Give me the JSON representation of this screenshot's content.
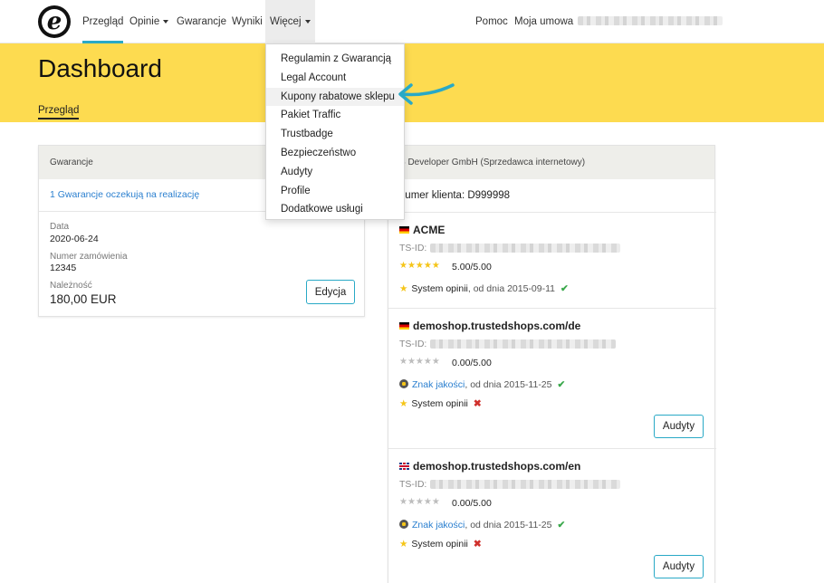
{
  "nav": {
    "items": [
      {
        "label": "Przegląd"
      },
      {
        "label": "Opinie"
      },
      {
        "label": "Gwarancje"
      },
      {
        "label": "Wyniki"
      },
      {
        "label": "Więcej"
      }
    ],
    "right": [
      {
        "label": "Pomoc"
      },
      {
        "label": "Moja umowa"
      }
    ],
    "logo_letter": "e"
  },
  "hero": {
    "title": "Dashboard",
    "subtab": "Przegląd"
  },
  "dropdown": {
    "items": [
      {
        "label": "Regulamin z Gwarancją"
      },
      {
        "label": "Legal Account"
      },
      {
        "label": "Kupony rabatowe sklepu"
      },
      {
        "label": "Pakiet Traffic"
      },
      {
        "label": "Trustbadge"
      },
      {
        "label": "Bezpieczeństwo"
      },
      {
        "label": "Audyty"
      },
      {
        "label": "Profile"
      },
      {
        "label": "Dodatkowe usługi"
      }
    ]
  },
  "guarantee_card": {
    "header": "Gwarancje",
    "pending_link": "1 Gwarancje oczekują na realizację",
    "date_label": "Data",
    "date_value": "2020-06-24",
    "order_label": "Numer zamówienia",
    "order_value": "12345",
    "due_label": "Należność",
    "due_value": "180,00 EUR",
    "edit_button": "Edycja"
  },
  "seller_card": {
    "header": "S Developer GmbH (Sprzedawca internetowy)",
    "client_number": "Numer klienta: D999998",
    "tsid_label": "TS-ID:",
    "shops": [
      {
        "name": "ACME",
        "flag": "de",
        "rating": "5.00/5.00",
        "stars_filled": 5,
        "reviews_text": "System opinii",
        "reviews_since": ", od dnia 2015-09-11",
        "reviews_ok": true
      },
      {
        "name": "demoshop.trustedshops.com/de",
        "flag": "de",
        "rating": "0.00/5.00",
        "stars_filled": 0,
        "quality_link": "Znak jakości",
        "quality_since": ", od dnia 2015-11-25",
        "reviews_text": "System opinii",
        "reviews_ok": false,
        "audit_button": "Audyty"
      },
      {
        "name": "demoshop.trustedshops.com/en",
        "flag": "gb",
        "rating": "0.00/5.00",
        "stars_filled": 0,
        "quality_link": "Znak jakości",
        "quality_since": ", od dnia 2015-11-25",
        "reviews_text": "System opinii",
        "reviews_ok": false,
        "audit_button": "Audyty"
      }
    ]
  },
  "colors": {
    "brand_yellow": "#fddb50",
    "accent": "#29a9c6",
    "link": "#2a7fcf",
    "ok_green": "#3aa84b",
    "error_red": "#d0312d"
  }
}
